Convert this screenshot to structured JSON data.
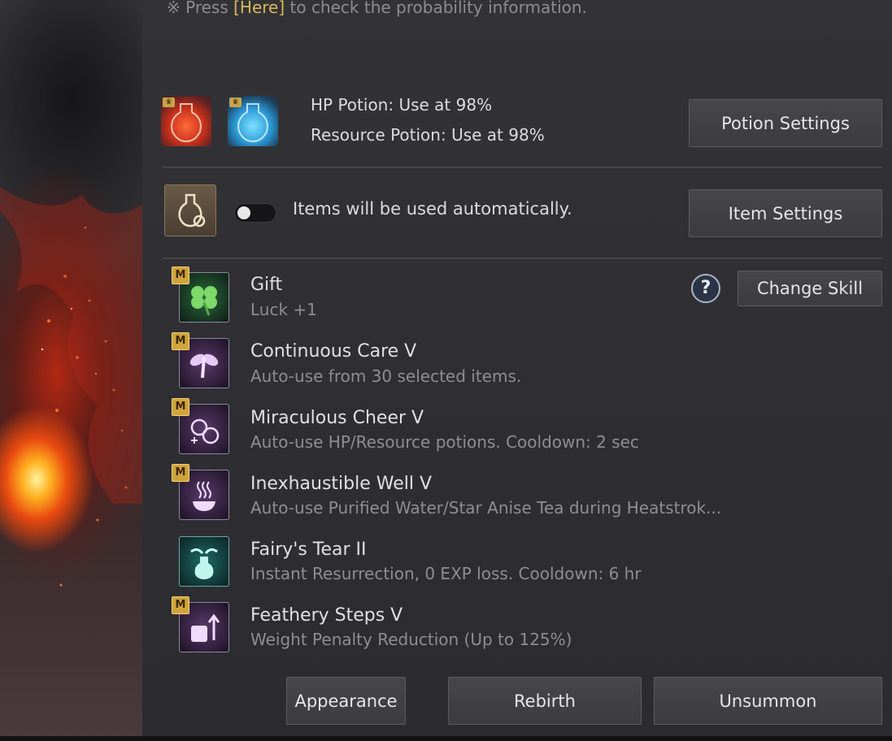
{
  "notice": {
    "prefix": "※ Press ",
    "link": "[Here]",
    "suffix": " to check the probability information."
  },
  "potions": {
    "hp_text": "HP Potion: Use at 98%",
    "resource_text": "Resource Potion: Use at 98%",
    "settings_button": "Potion Settings",
    "hp_potion_percent": 98,
    "resource_potion_percent": 98
  },
  "items": {
    "auto_text": "Items will be used automatically.",
    "toggle_on": false,
    "settings_button": "Item Settings"
  },
  "skills": [
    {
      "name": "Gift",
      "desc": "Luck +1",
      "badge": "M",
      "icon": "clover-icon"
    },
    {
      "name": "Continuous Care V",
      "desc": "Auto-use from 30 selected items.",
      "badge": "M",
      "icon": "fairy-icon"
    },
    {
      "name": "Miraculous Cheer V",
      "desc": "Auto-use HP/Resource potions. Cooldown: 2 sec",
      "badge": "M",
      "icon": "potions-plus-icon"
    },
    {
      "name": "Inexhaustible Well V",
      "desc": "Auto-use Purified Water/Star Anise Tea during Heatstrok...",
      "badge": "M",
      "icon": "steaming-bowl-icon"
    },
    {
      "name": "Fairy's Tear II",
      "desc": "Instant Resurrection, 0 EXP loss. Cooldown: 6 hr",
      "badge": "",
      "icon": "winged-vial-icon"
    },
    {
      "name": "Feathery Steps V",
      "desc": "Weight Penalty Reduction (Up to 125%)",
      "badge": "M",
      "icon": "weight-arrow-icon"
    }
  ],
  "change_skill_button": "Change Skill",
  "help_symbol": "?",
  "footer": {
    "appearance": "Appearance",
    "rebirth": "Rebirth",
    "unsummon": "Unsummon"
  },
  "colors": {
    "link": "#d8b85a",
    "badge": "#d0a43c",
    "panel": "#333337"
  }
}
